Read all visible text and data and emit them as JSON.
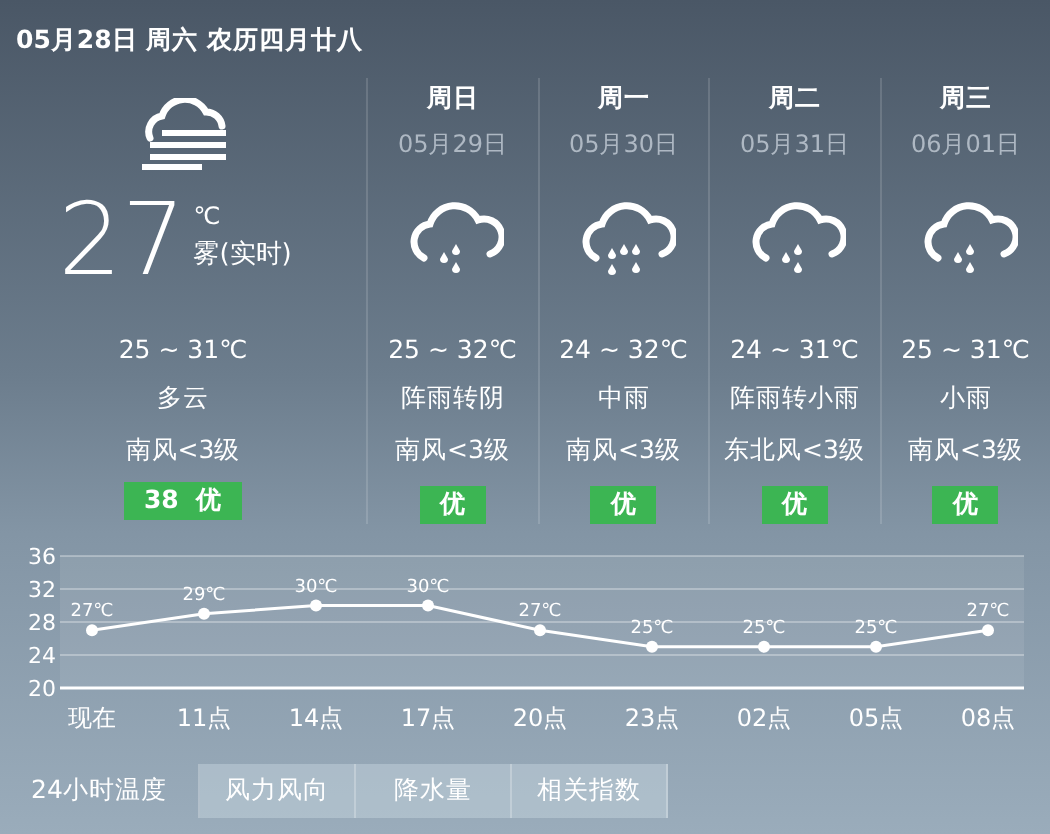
{
  "header": {
    "date": "05月28日 周六 农历四月廿八"
  },
  "today": {
    "kind": "fog",
    "temperature": "27",
    "unit": "℃",
    "condition": "雾(实时)",
    "range": "25 ~ 31℃",
    "weather": "多云",
    "wind": "南风<3级",
    "aqi": "38  优"
  },
  "forecast": [
    {
      "day": "周日",
      "date": "05月29日",
      "kind": "light_rain",
      "range": "25 ~ 32℃",
      "weather": "阵雨转阴",
      "wind": "南风<3级",
      "aqi": "优"
    },
    {
      "day": "周一",
      "date": "05月30日",
      "kind": "moderate_rain",
      "range": "24 ~ 32℃",
      "weather": "中雨",
      "wind": "南风<3级",
      "aqi": "优"
    },
    {
      "day": "周二",
      "date": "05月31日",
      "kind": "light_rain",
      "range": "24 ~ 31℃",
      "weather": "阵雨转小雨",
      "wind": "东北风<3级",
      "aqi": "优"
    },
    {
      "day": "周三",
      "date": "06月01日",
      "kind": "light_rain",
      "range": "25 ~ 31℃",
      "weather": "小雨",
      "wind": "南风<3级",
      "aqi": "优"
    }
  ],
  "hourly": {
    "chart_data": {
      "type": "line",
      "categories": [
        "现在",
        "11点",
        "14点",
        "17点",
        "20点",
        "23点",
        "02点",
        "05点",
        "08点"
      ],
      "series": [
        {
          "color": "#ffffff",
          "marker": true,
          "values": [
            27,
            29,
            30,
            30,
            27,
            25,
            25,
            25,
            27
          ]
        }
      ],
      "grid": true,
      "ylim": [
        20,
        36
      ],
      "yticks": [
        20,
        24,
        28,
        32,
        36
      ],
      "value_labels": [
        "27℃",
        "29℃",
        "30℃",
        "30℃",
        "27℃",
        "25℃",
        "25℃",
        "25℃",
        "27℃"
      ]
    }
  },
  "tabs": [
    {
      "label": "24小时温度",
      "selected": true
    },
    {
      "label": "风力风向",
      "selected": false
    },
    {
      "label": "降水量",
      "selected": false
    },
    {
      "label": "相关指数",
      "selected": false
    }
  ]
}
